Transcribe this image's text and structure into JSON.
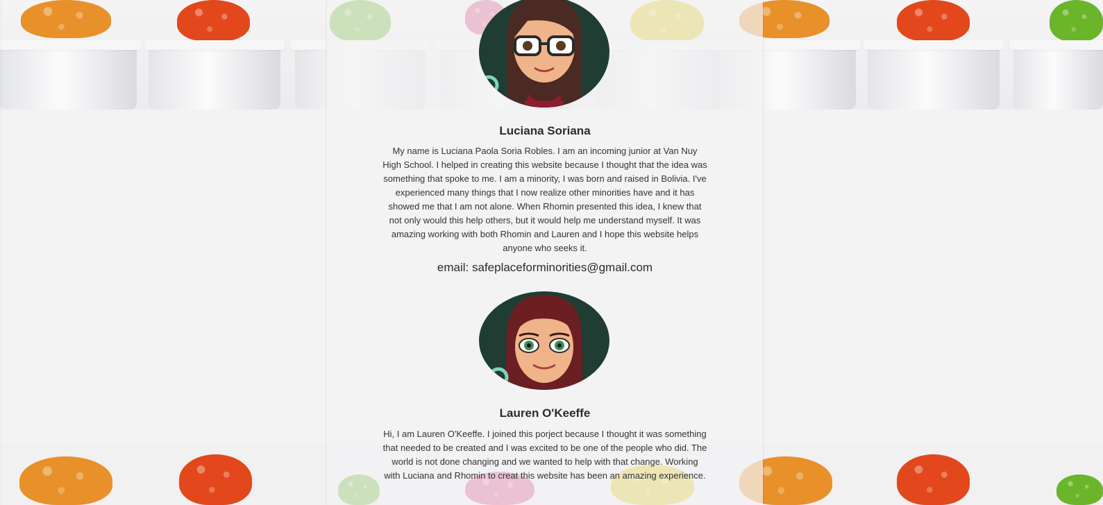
{
  "team": [
    {
      "name": "Luciana Soriana",
      "bio": "My name is Luciana Paola Soria Robles. I am an incoming junior at Van Nuy High School. I helped in creating this website because I thought that the idea was something that spoke to me. I am a minority, I was born and raised in Bolivia. I've experienced many things that I now realize other minorities have and it has showed me that I am not alone. When Rhomin presented this idea, I knew that not only would this help others, but it would help me understand myself. It was amazing working with both Rhomin and Lauren and I hope this website helps anyone who seeks it.",
      "email_label": "email: safeplaceforminorities@gmail.com",
      "avatar_icon": "bitmoji-avatar-glasses-brown-hair"
    },
    {
      "name": "Lauren O'Keeffe",
      "bio": "Hi, I am Lauren O'Keeffe. I joined this porject because I thought it was something that needed to be created and I was excited to be one of the people who did. The world is not done changing and we wanted to help with that change. Working with Luciana and Rhomin to creat this website has been an amazing experience.",
      "avatar_icon": "bitmoji-avatar-red-hair"
    }
  ],
  "colors": {
    "avatar_bg": "#1f3d33",
    "accent_ring": "#7fd3b8"
  }
}
